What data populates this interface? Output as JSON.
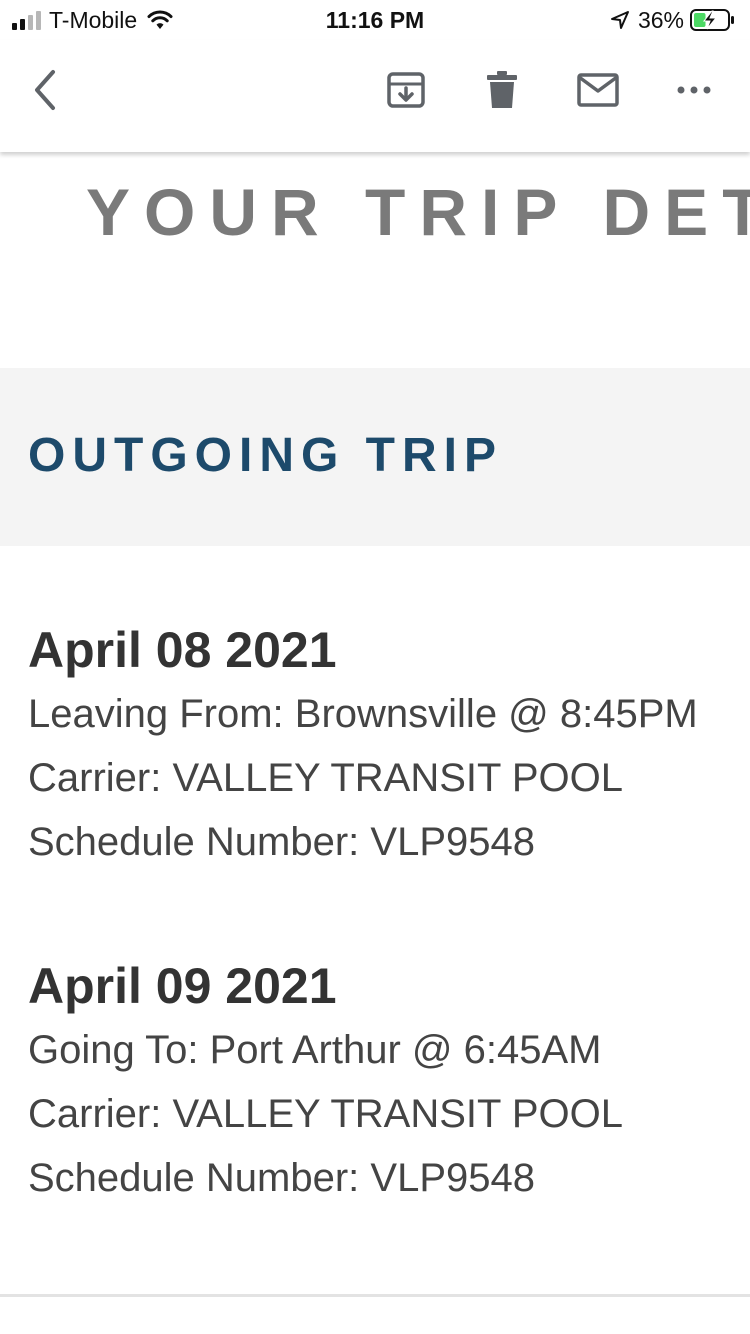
{
  "status_bar": {
    "carrier": "T-Mobile",
    "time": "11:16 PM",
    "battery_percent": "36%",
    "signal_bars_active": 2,
    "signal_bars_total": 4,
    "battery_level": 0.36,
    "battery_charging": true
  },
  "toolbar": {
    "icons": {
      "back": "chevron-left-icon",
      "archive": "archive-download-icon",
      "delete": "trash-icon",
      "mail": "envelope-icon",
      "more": "more-dots-icon"
    }
  },
  "email": {
    "heading": "YOUR TRIP DETAILS",
    "section_title": "OUTGOING TRIP",
    "trips": [
      {
        "date": "April 08 2021",
        "location_line": "Leaving From: Brownsville @ 8:45PM",
        "carrier_line": "Carrier: VALLEY TRANSIT POOL",
        "schedule_line": "Schedule Number: VLP9548"
      },
      {
        "date": "April 09 2021",
        "location_line": "Going To: Port Arthur @ 6:45AM",
        "carrier_line": "Carrier: VALLEY TRANSIT POOL",
        "schedule_line": "Schedule Number: VLP9548"
      }
    ]
  },
  "colors": {
    "section_title": "#1d4a6b",
    "heading": "#7a7a7a",
    "band": "#f4f4f4",
    "icon": "#5f6368",
    "battery_fill": "#4cd964"
  }
}
